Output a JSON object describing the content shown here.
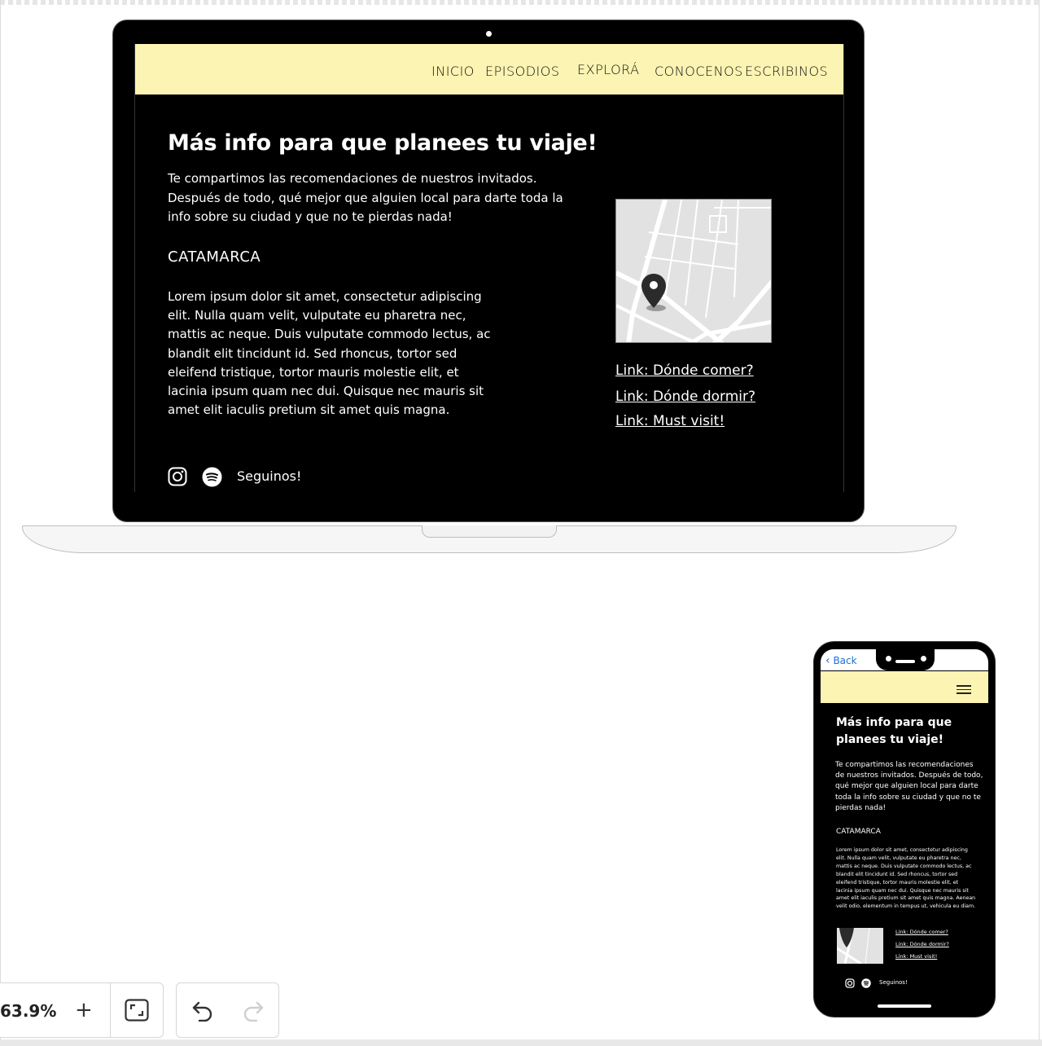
{
  "desktop": {
    "nav": [
      "INICIO",
      "EPISODIOS",
      "EXPLORÁ",
      "CONOCENOS",
      "ESCRIBINOS"
    ],
    "title": "Más info para que planees tu viaje!",
    "intro": "Te compartimos las recomendaciones de nuestros invitados. Después de todo, qué mejor que alguien local para darte toda la info sobre su ciudad y que no te pierdas nada!",
    "region": "CATAMARCA",
    "body": "Lorem ipsum dolor sit amet, consectetur adipiscing elit. Nulla quam velit, vulputate eu pharetra nec, mattis ac neque. Duis vulputate commodo lectus, ac blandit elit tincidunt id. Sed rhoncus, tortor sed eleifend tristique, tortor mauris molestie elit, et lacinia ipsum quam nec dui. Quisque nec mauris sit amet elit iaculis pretium sit amet quis magna.",
    "links": [
      "Link: Dónde comer?",
      "Link: Dónde dormir?",
      "Link: Must visit!"
    ],
    "follow": "Seguinos!"
  },
  "mobile": {
    "back_label": "Back",
    "title": "Más info para que planees tu viaje!",
    "intro": "Te compartimos las recomendaciones de nuestros invitados. Después de todo, qué mejor que alguien local para darte toda la info sobre su ciudad y que no te pierdas nada!",
    "region": "CATAMARCA",
    "body": "Lorem ipsum dolor sit amet, consectetur adipiscing elit. Nulla quam velit, vulputate eu pharetra nec, mattis ac neque. Duis vulputate commodo lectus, ac blandit elit tincidunt id. Sed rhoncus, tortor sed eleifend tristique, tortor mauris molestie elit, et lacinia ipsum quam nec dui. Quisque nec mauris sit amet elit iaculis pretium sit amet quis magna. Aenean velit odio, elementum in tempus ut, vehicula eu diam.",
    "links": [
      "Link: Dónde comer?",
      "Link: Dónde dormir?",
      "Link: Must visit!"
    ],
    "follow": "Seguinos!"
  },
  "toolbar": {
    "zoom": "63.9%",
    "zoom_in": "+"
  },
  "colors": {
    "nav_bg": "#fcf4b2",
    "screen_bg": "#000000",
    "back_link": "#1a6fd8"
  },
  "icons": [
    "camera-icon",
    "map-pin-icon",
    "instagram-icon",
    "spotify-icon",
    "hamburger-icon",
    "chevron-left-icon",
    "fit-screen-icon",
    "undo-icon",
    "redo-icon"
  ]
}
